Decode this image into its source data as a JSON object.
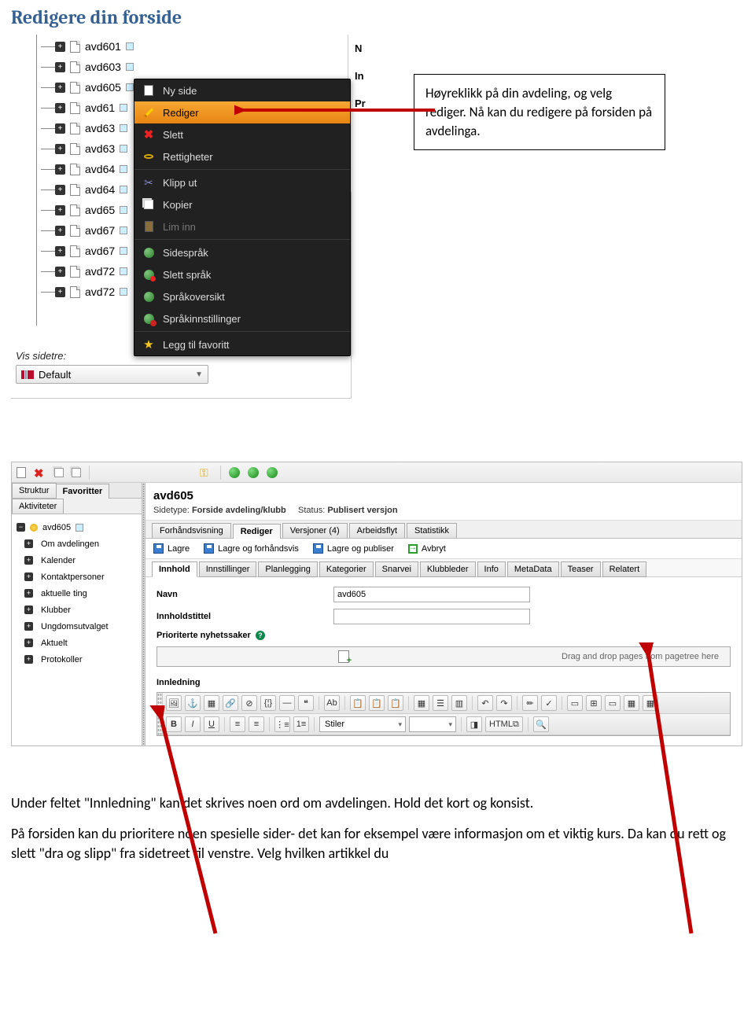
{
  "page_title": "Redigere din forside",
  "callout": "Høyreklikk på din avdeling, og velg rediger. Nå kan du redigere på forsiden på avdelinga.",
  "tree": {
    "items": [
      "avd601",
      "avd603",
      "avd605",
      "avd61",
      "avd63",
      "avd63",
      "avd64",
      "avd64",
      "avd65",
      "avd67",
      "avd67",
      "avd72",
      "avd72"
    ]
  },
  "sidetre": {
    "label": "Vis sidetre:",
    "selected": "Default"
  },
  "right_preview_letters": [
    "N",
    "In",
    "Pr"
  ],
  "context_menu": {
    "items": [
      {
        "label": "Ny side",
        "icon": "page"
      },
      {
        "label": "Rediger",
        "icon": "pencil",
        "hl": true
      },
      {
        "label": "Slett",
        "icon": "x"
      },
      {
        "label": "Rettigheter",
        "icon": "key"
      },
      {
        "sep": true
      },
      {
        "label": "Klipp ut",
        "icon": "scissors"
      },
      {
        "label": "Kopier",
        "icon": "copy"
      },
      {
        "label": "Lim inn",
        "icon": "paste",
        "disabled": true
      },
      {
        "sep": true
      },
      {
        "label": "Sidespråk",
        "icon": "globe"
      },
      {
        "label": "Slett språk",
        "icon": "globe-red"
      },
      {
        "label": "Språkoversikt",
        "icon": "globe"
      },
      {
        "label": "Språkinnstillinger",
        "icon": "globe-gear"
      },
      {
        "sep": true
      },
      {
        "label": "Legg til favoritt",
        "icon": "star"
      }
    ]
  },
  "editor": {
    "left_tabs": {
      "struktur": "Struktur",
      "favoritter": "Favoritter",
      "aktiviteter": "Aktiviteter"
    },
    "current_page": "avd605",
    "left_tree": [
      "Om avdelingen",
      "Kalender",
      "Kontaktpersoner",
      "aktuelle ting",
      "Klubber",
      "Ungdomsutvalget",
      "Aktuelt",
      "Protokoller"
    ],
    "header_title": "avd605",
    "sidetype_label": "Sidetype:",
    "sidetype_value": "Forside avdeling/klubb",
    "status_label": "Status:",
    "status_value": "Publisert versjon",
    "view_tabs": [
      "Forhåndsvisning",
      "Rediger",
      "Versjoner (4)",
      "Arbeidsflyt",
      "Statistikk"
    ],
    "view_active": "Rediger",
    "actions": {
      "save": "Lagre",
      "save_preview": "Lagre og forhåndsvis",
      "save_publish": "Lagre og publiser",
      "abort": "Avbryt"
    },
    "content_tabs": [
      "Innhold",
      "Innstillinger",
      "Planlegging",
      "Kategorier",
      "Snarvei",
      "Klubbleder",
      "Info",
      "MetaData",
      "Teaser",
      "Relatert"
    ],
    "content_active": "Innhold",
    "form": {
      "navn_label": "Navn",
      "navn_value": "avd605",
      "innholdstittel_label": "Innholdstittel",
      "innholdstittel_value": "",
      "prioriterte_label": "Prioriterte nyhetssaker",
      "drop_hint": "Drag and drop pages from pagetree here",
      "innledning_label": "Innledning"
    },
    "rte_styles": "Stiler",
    "rte_html": "HTML"
  },
  "body_paragraphs": [
    "Under feltet \"Innledning\" kan det skrives noen ord om avdelingen. Hold det kort og konsist.",
    "På forsiden kan du prioritere noen spesielle sider- det kan for eksempel være informasjon om et viktig kurs. Da kan du rett og slett \"dra og slipp\" fra sidetreet til venstre. Velg hvilken artikkel du"
  ]
}
